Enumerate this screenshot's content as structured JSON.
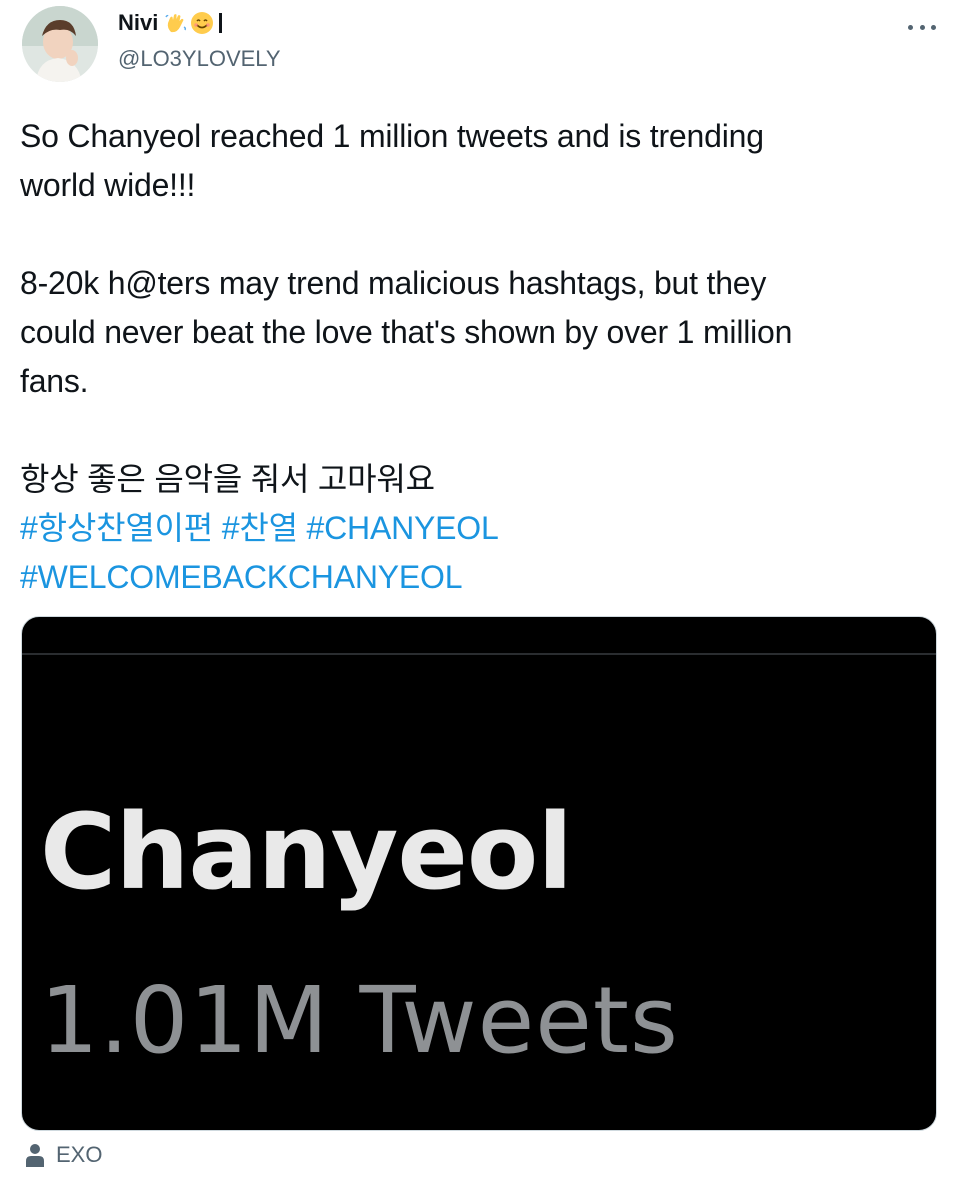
{
  "author": {
    "display_name": "Nivi",
    "name_suffix_icons": [
      "waving-hand-emoji",
      "smiling-face-emoji"
    ],
    "handle": "@LO3YLOVELY"
  },
  "menu": {
    "more_icon": "more-horizontal-icon"
  },
  "tweet": {
    "line1": "So Chanyeol reached 1 million tweets and is trending",
    "line2": "world wide!!!",
    "line3": "8-20k h@ters may trend malicious hashtags, but they",
    "line4": "could never beat the love that's shown by over 1 million",
    "line5": "fans.",
    "line6": "항상 좋은 음악을 줘서 고마워요",
    "hashtags_row1": [
      "#항상찬열이편",
      "#찬열",
      "#CHANYEOL"
    ],
    "hashtags_row2": [
      "#WELCOMEBACKCHANYEOL"
    ]
  },
  "media": {
    "trend_name": "Chanyeol",
    "trend_count": "1.01M Tweets"
  },
  "tagged": {
    "icon": "person-icon",
    "label": "EXO"
  },
  "colors": {
    "link": "#1b95e0",
    "secondary_text": "#536471",
    "media_bg": "#000000"
  }
}
